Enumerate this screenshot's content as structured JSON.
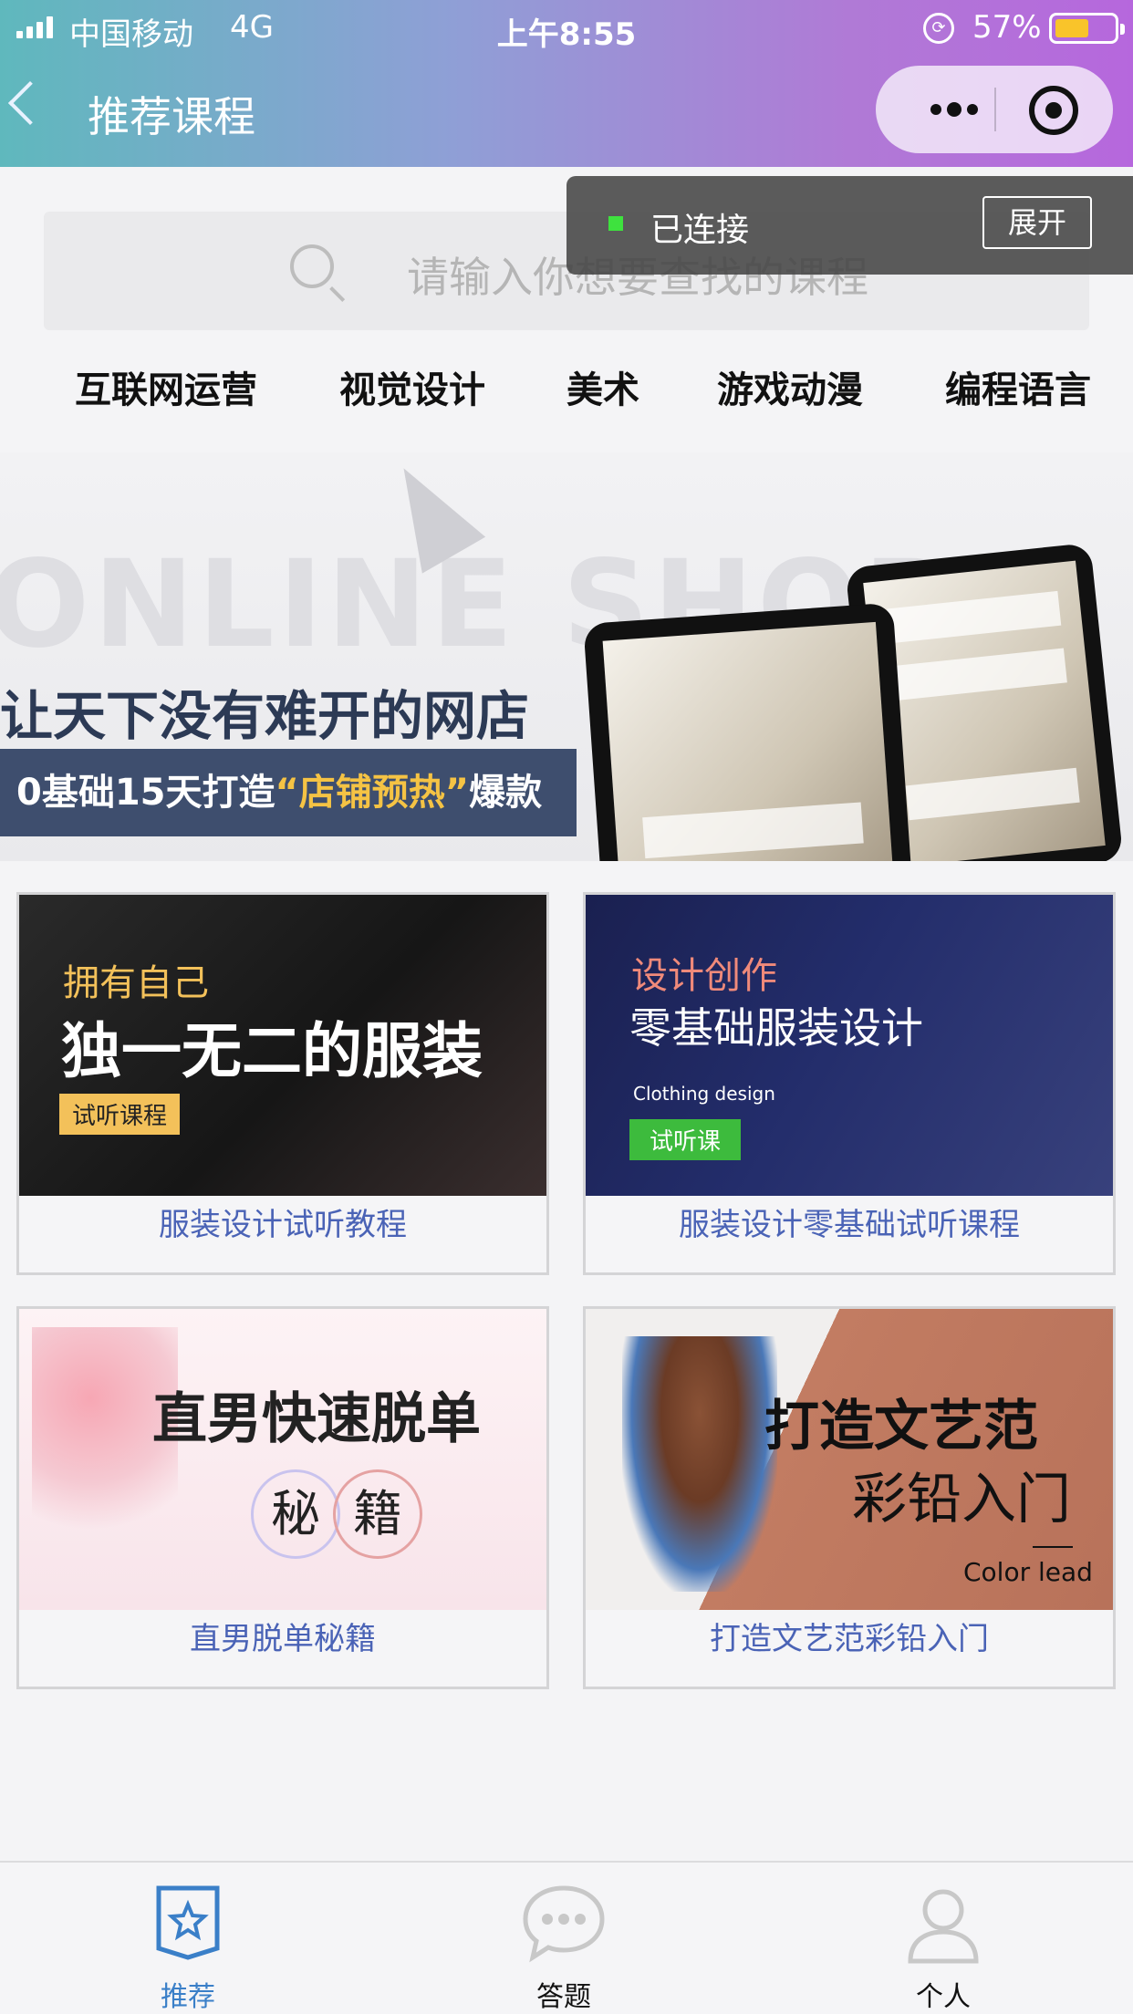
{
  "status_bar": {
    "carrier": "中国移动",
    "network": "4G",
    "time": "上午8:55",
    "battery_percent": "57%"
  },
  "nav": {
    "title": "推荐课程"
  },
  "search": {
    "placeholder": "请输入你想要查找的课程"
  },
  "toast": {
    "status": "已连接",
    "expand_label": "展开",
    "dot_color": "#3ee23e"
  },
  "categories": [
    "互联网运营",
    "视觉设计",
    "美术",
    "游戏动漫",
    "编程语言"
  ],
  "banner": {
    "bg_text": "ONLINE SHOP",
    "headline": "让天下没有难开的网店",
    "sub_prefix": "0基础15天打造",
    "sub_highlight": "“店铺预热”",
    "sub_suffix": "爆款"
  },
  "courses": [
    {
      "title": "服装设计试听教程",
      "img_line1": "拥有自己",
      "img_line2": "独一无二的服装",
      "img_badge": "试听课程"
    },
    {
      "title": "服装设计零基础试听课程",
      "img_line1": "设计创作",
      "img_line2": "零基础服装设计",
      "img_line3": "Clothing design",
      "img_badge": "试听课"
    },
    {
      "title": "直男脱单秘籍",
      "img_line1": "直男快速脱单",
      "img_char1": "秘",
      "img_char2": "籍"
    },
    {
      "title": "打造文艺范彩铅入门",
      "img_line1": "打造文艺范",
      "img_line2": "彩铅入门",
      "img_line3": "Color lead"
    }
  ],
  "tabbar": {
    "items": [
      {
        "label": "推荐",
        "icon": "star-icon",
        "active": true
      },
      {
        "label": "答题",
        "icon": "chat-bubble-icon",
        "active": false
      },
      {
        "label": "个人",
        "icon": "person-icon",
        "active": false
      }
    ],
    "active_color": "#3a7fc8"
  },
  "colors": {
    "header_gradient_start": "#5fb8bd",
    "header_gradient_end": "#b667dd",
    "caption_color": "#4a63b6"
  }
}
